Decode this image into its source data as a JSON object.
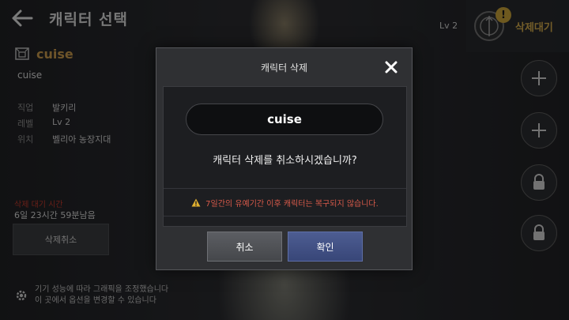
{
  "header": {
    "title": "캐릭터 선택"
  },
  "top_right": {
    "level": "Lv 2",
    "status": "삭제대기",
    "badge": "!"
  },
  "character": {
    "name": "cuise",
    "sub_name": "cuise",
    "info": [
      {
        "key": "직업",
        "value": "발키리"
      },
      {
        "key": "레벨",
        "value": "Lv 2"
      },
      {
        "key": "위치",
        "value": "벨리아 농장지대"
      }
    ],
    "remain_label": "삭제 대기 시간",
    "remain_time": "6일 23시간 59분남음",
    "cancel_delete_label": "삭제취소"
  },
  "settings": {
    "line1": "기기 성능에 따라 그래픽을 조정했습니다",
    "line2": "이 곳에서 옵션을 변경할 수 있습니다"
  },
  "dialog": {
    "title": "캐릭터 삭제",
    "name": "cuise",
    "question": "캐릭터 삭제를 취소하시겠습니까?",
    "warning": "7일간의 유예기간 이후 캐릭터는 복구되지 않습니다.",
    "cancel_label": "취소",
    "confirm_label": "확인"
  },
  "colors": {
    "accent_gold": "#c89a4c",
    "warning_red": "#d85a4a",
    "confirm_blue": "#4d5d92"
  },
  "icons": [
    "back-arrow-icon",
    "server-emblem-icon",
    "class-emblem-icon",
    "plus-icon",
    "lock-icon",
    "gear-icon",
    "close-icon",
    "warning-icon"
  ]
}
